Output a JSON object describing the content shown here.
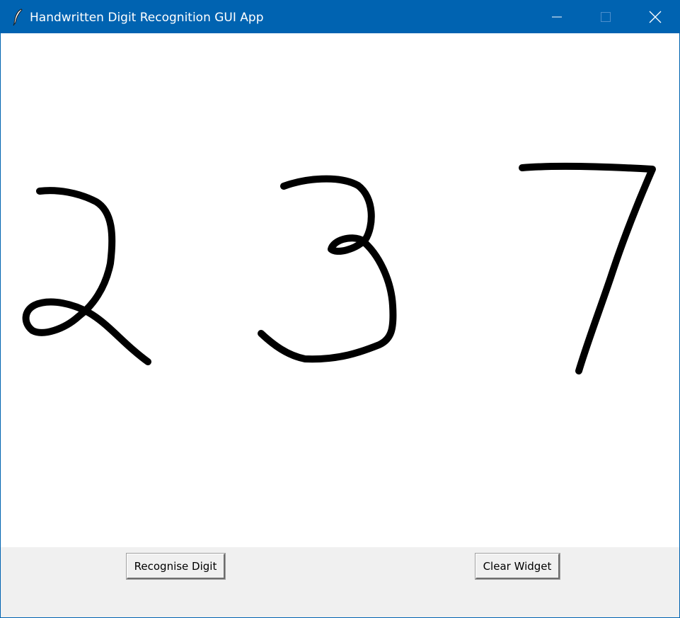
{
  "window": {
    "title": "Handwritten Digit Recognition GUI App",
    "titlebar_color": "#0063b1",
    "controls": {
      "minimize": "minimize-icon",
      "maximize": "maximize-icon",
      "close": "close-icon"
    }
  },
  "canvas": {
    "background": "#ffffff",
    "stroke_color": "#000000",
    "drawn_digits": [
      "2",
      "3",
      "7"
    ]
  },
  "buttons": {
    "recognise_label": "Recognise Digit",
    "clear_label": "Clear Widget"
  },
  "panel_color": "#f0f0f0"
}
